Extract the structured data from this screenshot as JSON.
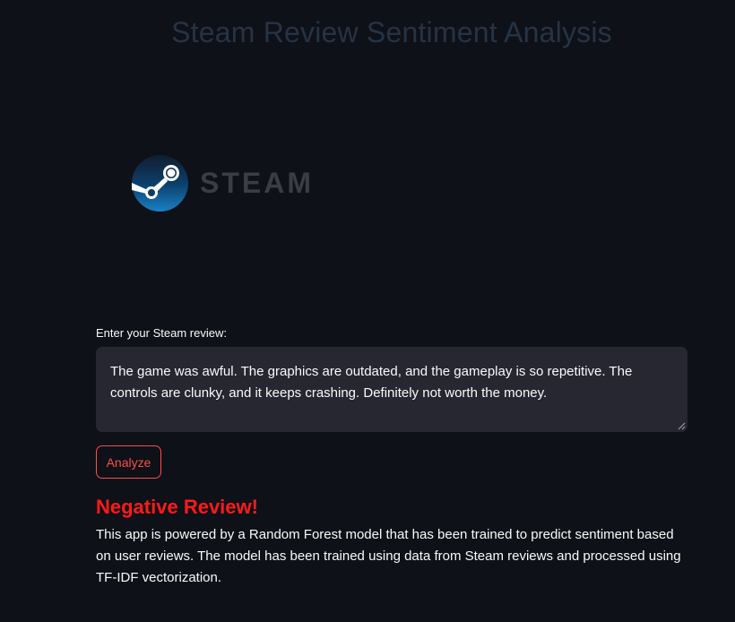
{
  "app": {
    "title": "Steam Review Sentiment Analysis"
  },
  "logo": {
    "icon": "steam-logo-icon",
    "text": "STEAM"
  },
  "review": {
    "label": "Enter your Steam review:",
    "value": "The game was awful. The graphics are outdated, and the gameplay is so repetitive. The controls are clunky, and it keeps crashing. Definitely not worth the money."
  },
  "actions": {
    "analyze_label": "Analyze"
  },
  "result": {
    "text": "Negative Review!",
    "color": "#ff1a1a"
  },
  "info": {
    "description": "This app is powered by a Random Forest model that has been trained to predict sentiment based on user reviews. The model has been trained using data from Steam reviews and processed using TF-IDF vectorization."
  },
  "theme": {
    "background": "#0e1117",
    "accent": "#ff4b4b",
    "input_background": "#262730"
  }
}
